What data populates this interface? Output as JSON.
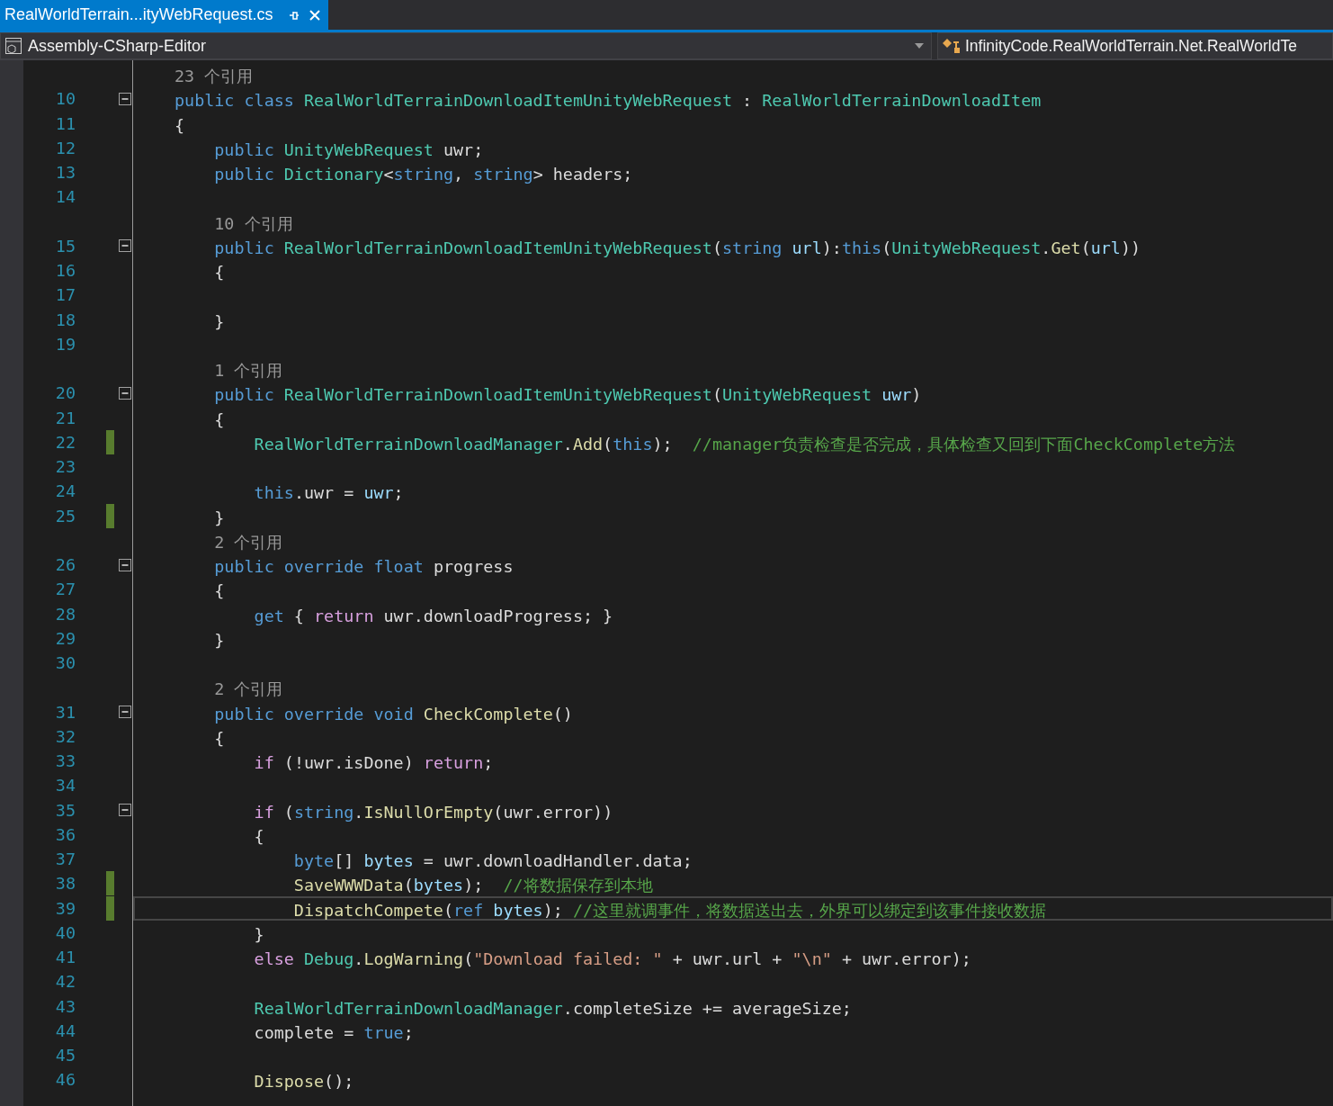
{
  "tabs": [
    {
      "label": "RealWorldTerrain...ityWebRequest.cs",
      "selected": true
    }
  ],
  "navigation": {
    "project": "Assembly-CSharp-Editor",
    "type": "InfinityCode.RealWorldTerrain.Net.RealWorldTe"
  },
  "lines": [
    {
      "kind": "lens",
      "text": "23 个引用"
    },
    {
      "kind": "code",
      "number": "10",
      "fold": {
        "expanded": true
      },
      "changed": false,
      "current": false,
      "tokens": [
        {
          "kind": "keyword",
          "text": "public class "
        },
        {
          "kind": "type",
          "text": "RealWorldTerrainDownloadItemUnityWebRequest"
        },
        {
          "kind": "plain",
          "text": " : "
        },
        {
          "kind": "type",
          "text": "RealWorldTerrainDownloadItem"
        }
      ]
    },
    {
      "kind": "code",
      "number": "11",
      "changed": false,
      "current": false,
      "tokens": [
        {
          "kind": "plain",
          "text": "{"
        }
      ]
    },
    {
      "kind": "code",
      "number": "12",
      "changed": false,
      "current": false,
      "tokens": [
        {
          "kind": "keyword",
          "text": "    public "
        },
        {
          "kind": "type",
          "text": "UnityWebRequest"
        },
        {
          "kind": "plain",
          "text": " uwr;"
        }
      ]
    },
    {
      "kind": "code",
      "number": "13",
      "changed": false,
      "current": false,
      "tokens": [
        {
          "kind": "keyword",
          "text": "    public "
        },
        {
          "kind": "type",
          "text": "Dictionary"
        },
        {
          "kind": "plain",
          "text": "<"
        },
        {
          "kind": "keyword",
          "text": "string"
        },
        {
          "kind": "plain",
          "text": ", "
        },
        {
          "kind": "keyword",
          "text": "string"
        },
        {
          "kind": "plain",
          "text": "> headers;"
        }
      ]
    },
    {
      "kind": "code",
      "number": "14",
      "changed": false,
      "current": false
    },
    {
      "kind": "lens",
      "text": "    10 个引用"
    },
    {
      "kind": "code",
      "number": "15",
      "fold": {
        "expanded": true
      },
      "changed": false,
      "current": false,
      "tokens": [
        {
          "kind": "keyword",
          "text": "    public "
        },
        {
          "kind": "type",
          "text": "RealWorldTerrainDownloadItemUnityWebRequest"
        },
        {
          "kind": "plain",
          "text": "("
        },
        {
          "kind": "keyword",
          "text": "string "
        },
        {
          "kind": "variable",
          "text": "url"
        },
        {
          "kind": "plain",
          "text": "):"
        },
        {
          "kind": "keyword",
          "text": "this"
        },
        {
          "kind": "plain",
          "text": "("
        },
        {
          "kind": "type",
          "text": "UnityWebRequest"
        },
        {
          "kind": "plain",
          "text": "."
        },
        {
          "kind": "method",
          "text": "Get"
        },
        {
          "kind": "plain",
          "text": "("
        },
        {
          "kind": "variable",
          "text": "url"
        },
        {
          "kind": "plain",
          "text": "))"
        }
      ]
    },
    {
      "kind": "code",
      "number": "16",
      "changed": false,
      "current": false,
      "tokens": [
        {
          "kind": "plain",
          "text": "    {"
        }
      ]
    },
    {
      "kind": "code",
      "number": "17",
      "changed": false,
      "current": false
    },
    {
      "kind": "code",
      "number": "18",
      "changed": false,
      "current": false,
      "tokens": [
        {
          "kind": "plain",
          "text": "    }"
        }
      ]
    },
    {
      "kind": "code",
      "number": "19",
      "changed": false,
      "current": false
    },
    {
      "kind": "lens",
      "text": "    1 个引用"
    },
    {
      "kind": "code",
      "number": "20",
      "fold": {
        "expanded": true
      },
      "changed": false,
      "current": false,
      "tokens": [
        {
          "kind": "keyword",
          "text": "    public "
        },
        {
          "kind": "type",
          "text": "RealWorldTerrainDownloadItemUnityWebRequest"
        },
        {
          "kind": "plain",
          "text": "("
        },
        {
          "kind": "type",
          "text": "UnityWebRequest "
        },
        {
          "kind": "variable",
          "text": "uwr"
        },
        {
          "kind": "plain",
          "text": ")"
        }
      ]
    },
    {
      "kind": "code",
      "number": "21",
      "changed": false,
      "current": false,
      "tokens": [
        {
          "kind": "plain",
          "text": "    {"
        }
      ]
    },
    {
      "kind": "code",
      "number": "22",
      "changed": true,
      "current": false,
      "tokens": [
        {
          "kind": "type",
          "text": "        RealWorldTerrainDownloadManager"
        },
        {
          "kind": "plain",
          "text": "."
        },
        {
          "kind": "method",
          "text": "Add"
        },
        {
          "kind": "plain",
          "text": "("
        },
        {
          "kind": "keyword",
          "text": "this"
        },
        {
          "kind": "plain",
          "text": ");  "
        },
        {
          "kind": "comment",
          "text": "//manager负责检查是否完成，具体检查又回到下面CheckComplete方法"
        }
      ]
    },
    {
      "kind": "code",
      "number": "23",
      "changed": false,
      "current": false
    },
    {
      "kind": "code",
      "number": "24",
      "changed": false,
      "current": false,
      "tokens": [
        {
          "kind": "keyword",
          "text": "        this"
        },
        {
          "kind": "plain",
          "text": ".uwr = "
        },
        {
          "kind": "variable",
          "text": "uwr"
        },
        {
          "kind": "plain",
          "text": ";"
        }
      ]
    },
    {
      "kind": "code",
      "number": "25",
      "changed": true,
      "current": false,
      "tokens": [
        {
          "kind": "plain",
          "text": "    }"
        }
      ]
    },
    {
      "kind": "lens",
      "text": "    2 个引用"
    },
    {
      "kind": "code",
      "number": "26",
      "fold": {
        "expanded": true
      },
      "changed": false,
      "current": false,
      "tokens": [
        {
          "kind": "keyword",
          "text": "    public override float "
        },
        {
          "kind": "plain",
          "text": "progress"
        }
      ]
    },
    {
      "kind": "code",
      "number": "27",
      "changed": false,
      "current": false,
      "tokens": [
        {
          "kind": "plain",
          "text": "    {"
        }
      ]
    },
    {
      "kind": "code",
      "number": "28",
      "changed": false,
      "current": false,
      "tokens": [
        {
          "kind": "keyword",
          "text": "        get"
        },
        {
          "kind": "plain",
          "text": " { "
        },
        {
          "kind": "control",
          "text": "return"
        },
        {
          "kind": "plain",
          "text": " uwr.downloadProgress; }"
        }
      ]
    },
    {
      "kind": "code",
      "number": "29",
      "changed": false,
      "current": false,
      "tokens": [
        {
          "kind": "plain",
          "text": "    }"
        }
      ]
    },
    {
      "kind": "code",
      "number": "30",
      "changed": false,
      "current": false
    },
    {
      "kind": "lens",
      "text": "    2 个引用"
    },
    {
      "kind": "code",
      "number": "31",
      "fold": {
        "expanded": true
      },
      "changed": false,
      "current": false,
      "tokens": [
        {
          "kind": "keyword",
          "text": "    public override void "
        },
        {
          "kind": "method",
          "text": "CheckComplete"
        },
        {
          "kind": "plain",
          "text": "()"
        }
      ]
    },
    {
      "kind": "code",
      "number": "32",
      "changed": false,
      "current": false,
      "tokens": [
        {
          "kind": "plain",
          "text": "    {"
        }
      ]
    },
    {
      "kind": "code",
      "number": "33",
      "changed": false,
      "current": false,
      "tokens": [
        {
          "kind": "control",
          "text": "        if"
        },
        {
          "kind": "plain",
          "text": " (!uwr.isDone) "
        },
        {
          "kind": "control",
          "text": "return"
        },
        {
          "kind": "plain",
          "text": ";"
        }
      ]
    },
    {
      "kind": "code",
      "number": "34",
      "changed": false,
      "current": false
    },
    {
      "kind": "code",
      "number": "35",
      "fold": {
        "expanded": true
      },
      "changed": false,
      "current": false,
      "tokens": [
        {
          "kind": "control",
          "text": "        if"
        },
        {
          "kind": "plain",
          "text": " ("
        },
        {
          "kind": "keyword",
          "text": "string"
        },
        {
          "kind": "plain",
          "text": "."
        },
        {
          "kind": "method",
          "text": "IsNullOrEmpty"
        },
        {
          "kind": "plain",
          "text": "(uwr.error))"
        }
      ]
    },
    {
      "kind": "code",
      "number": "36",
      "changed": false,
      "current": false,
      "tokens": [
        {
          "kind": "plain",
          "text": "        {"
        }
      ]
    },
    {
      "kind": "code",
      "number": "37",
      "changed": false,
      "current": false,
      "tokens": [
        {
          "kind": "keyword",
          "text": "            byte"
        },
        {
          "kind": "plain",
          "text": "[] "
        },
        {
          "kind": "variable",
          "text": "bytes"
        },
        {
          "kind": "plain",
          "text": " = uwr.downloadHandler.data;"
        }
      ]
    },
    {
      "kind": "code",
      "number": "38",
      "changed": true,
      "current": false,
      "tokens": [
        {
          "kind": "method",
          "text": "            SaveWWWData"
        },
        {
          "kind": "plain",
          "text": "("
        },
        {
          "kind": "variable",
          "text": "bytes"
        },
        {
          "kind": "plain",
          "text": ");  "
        },
        {
          "kind": "comment",
          "text": "//将数据保存到本地"
        }
      ]
    },
    {
      "kind": "code",
      "number": "39",
      "changed": true,
      "current": true,
      "tokens": [
        {
          "kind": "method",
          "text": "            DispatchCompete"
        },
        {
          "kind": "plain",
          "text": "("
        },
        {
          "kind": "keyword",
          "text": "ref "
        },
        {
          "kind": "variable",
          "text": "bytes"
        },
        {
          "kind": "plain",
          "text": "); "
        },
        {
          "kind": "comment",
          "text": "//这里就调事件，将数据送出去，外界可以绑定到该事件接收数据"
        }
      ]
    },
    {
      "kind": "code",
      "number": "40",
      "changed": false,
      "current": false,
      "tokens": [
        {
          "kind": "plain",
          "text": "        }"
        }
      ]
    },
    {
      "kind": "code",
      "number": "41",
      "changed": false,
      "current": false,
      "tokens": [
        {
          "kind": "control",
          "text": "        else "
        },
        {
          "kind": "type",
          "text": "Debug"
        },
        {
          "kind": "plain",
          "text": "."
        },
        {
          "kind": "method",
          "text": "LogWarning"
        },
        {
          "kind": "plain",
          "text": "("
        },
        {
          "kind": "string",
          "text": "\"Download failed: \""
        },
        {
          "kind": "plain",
          "text": " + uwr.url + "
        },
        {
          "kind": "string",
          "text": "\"\\n\""
        },
        {
          "kind": "plain",
          "text": " + uwr.error);"
        }
      ]
    },
    {
      "kind": "code",
      "number": "42",
      "changed": false,
      "current": false
    },
    {
      "kind": "code",
      "number": "43",
      "changed": false,
      "current": false,
      "tokens": [
        {
          "kind": "type",
          "text": "        RealWorldTerrainDownloadManager"
        },
        {
          "kind": "plain",
          "text": ".completeSize += averageSize;"
        }
      ]
    },
    {
      "kind": "code",
      "number": "44",
      "changed": false,
      "current": false,
      "tokens": [
        {
          "kind": "plain",
          "text": "        complete = "
        },
        {
          "kind": "keyword",
          "text": "true"
        },
        {
          "kind": "plain",
          "text": ";"
        }
      ]
    },
    {
      "kind": "code",
      "number": "45",
      "changed": false,
      "current": false
    },
    {
      "kind": "code",
      "number": "46",
      "changed": false,
      "current": false,
      "tokens": [
        {
          "kind": "method",
          "text": "        Dispose"
        },
        {
          "kind": "plain",
          "text": "();"
        }
      ]
    }
  ]
}
